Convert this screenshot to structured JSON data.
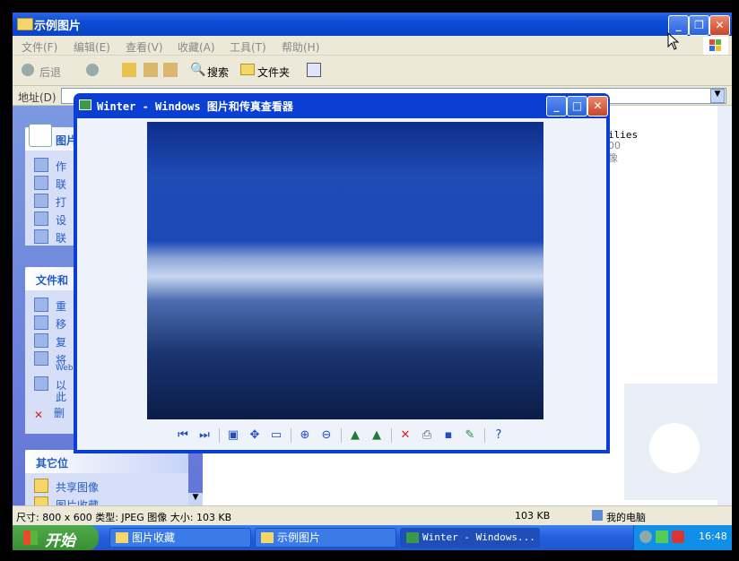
{
  "explorer": {
    "title": "示例图片",
    "menu": [
      "文件(F)",
      "编辑(E)",
      "查看(V)",
      "收藏(A)",
      "工具(T)",
      "帮助(H)"
    ],
    "toolbar": {
      "back": "后退",
      "search": "搜索",
      "folders": "文件夹"
    },
    "address_label": "地址(D)",
    "sidebar": {
      "panel1": {
        "title": "图片",
        "items": [
          "作",
          "联",
          "打",
          "设",
          "联"
        ]
      },
      "panel2": {
        "title": "文件和",
        "items": [
          "重",
          "移",
          "复",
          "将",
          "Web",
          "以",
          "此",
          "删"
        ]
      },
      "panel3": {
        "title": "其它位",
        "items": [
          "共享图像",
          "图片收藏"
        ]
      }
    },
    "content_snippet": [
      "ilies",
      "00",
      "像"
    ],
    "status": {
      "left": "尺寸: 800 x 600 类型: JPEG 图像 大小: 103 KB",
      "size": "103 KB",
      "location": "我的电脑"
    }
  },
  "viewer": {
    "title": "Winter - Windows 图片和传真查看器",
    "toolbar_icons": [
      "prev-image-icon",
      "next-image-icon",
      "best-fit-icon",
      "actual-size-icon",
      "slideshow-icon",
      "zoom-in-icon",
      "zoom-out-icon",
      "rotate-clockwise-icon",
      "rotate-counterclockwise-icon",
      "delete-icon",
      "print-icon",
      "save-icon",
      "edit-icon",
      "help-icon"
    ]
  },
  "taskbar": {
    "start": "开始",
    "tasks": [
      "图片收藏",
      "示例图片",
      "Winter - Windows..."
    ],
    "clock": "16:48"
  },
  "colors": {
    "xp_blue": "#0a4bd6",
    "taskbar": "#245edb",
    "start_green": "#3a8f33"
  }
}
